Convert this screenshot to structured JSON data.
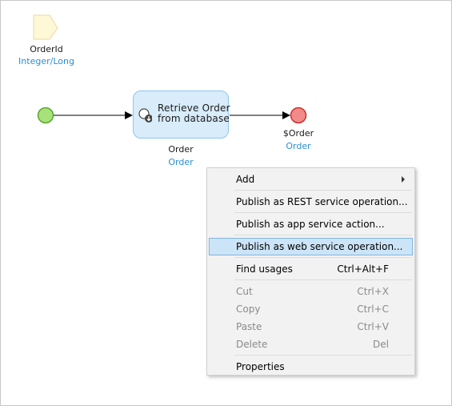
{
  "parameter": {
    "name": "OrderId",
    "type": "Integer/Long"
  },
  "activity": {
    "line1": "Retrieve Order",
    "line2": "from database",
    "output_name": "Order",
    "output_type": "Order"
  },
  "end_event": {
    "return_value": "$Order",
    "return_type": "Order"
  },
  "context_menu": {
    "add": "Add",
    "publish_rest": "Publish as REST service operation...",
    "publish_app": "Publish as app service action...",
    "publish_web": "Publish as web service operation...",
    "find_usages": "Find usages",
    "find_usages_shortcut": "Ctrl+Alt+F",
    "cut": "Cut",
    "cut_shortcut": "Ctrl+X",
    "copy": "Copy",
    "copy_shortcut": "Ctrl+C",
    "paste": "Paste",
    "paste_shortcut": "Ctrl+V",
    "delete": "Delete",
    "delete_shortcut": "Del",
    "properties": "Properties"
  },
  "colors": {
    "start": "#a8e07a",
    "end": "#f28a8a",
    "activity_bg": "#d8ecfa",
    "link_blue": "#2a8fd0",
    "highlight": "#cce4f7"
  }
}
